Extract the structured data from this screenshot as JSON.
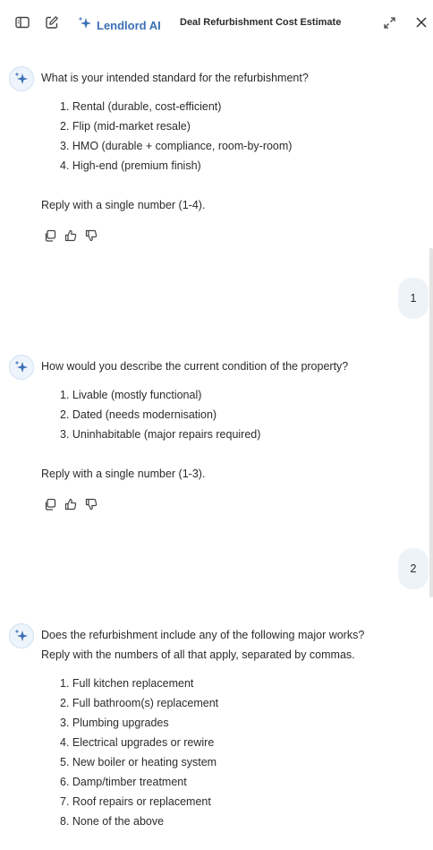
{
  "header": {
    "brand": "Lendlord AI",
    "title": "Deal Refurbishment Cost Estimate"
  },
  "messages": [
    {
      "question": "What is your intended standard for the refurbishment?",
      "options": [
        "1. Rental (durable, cost-efficient)",
        "2. Flip (mid-market resale)",
        "3. HMO (durable + compliance, room-by-room)",
        "4. High-end (premium finish)"
      ],
      "reply_hint": "Reply with a single number (1-4)."
    },
    {
      "question": "How would you describe the current condition of the property?",
      "options": [
        "1. Livable (mostly functional)",
        "2. Dated (needs modernisation)",
        "3. Uninhabitable (major repairs required)"
      ],
      "reply_hint": "Reply with a single number (1-3)."
    },
    {
      "question": "Does the refurbishment include any of the following major works?",
      "question_line2": "Reply with the numbers of all that apply, separated by commas.",
      "options": [
        "1. Full kitchen replacement",
        "2. Full bathroom(s) replacement",
        "3. Plumbing upgrades",
        "4. Electrical upgrades or rewire",
        "5. New boiler or heating system",
        "6. Damp/timber treatment",
        "7. Roof repairs or replacement",
        "8. None of the above"
      ]
    }
  ],
  "user_replies": [
    "1",
    "2"
  ]
}
